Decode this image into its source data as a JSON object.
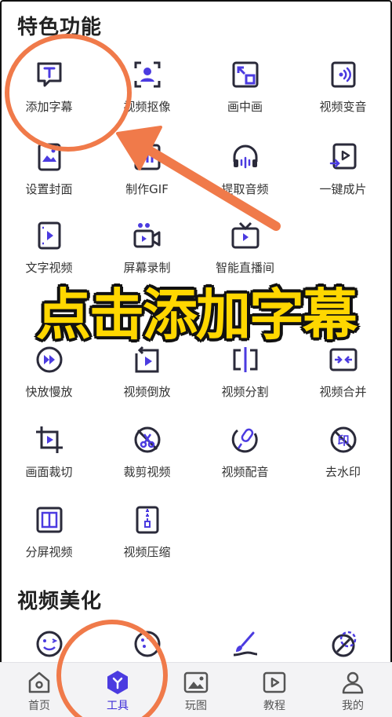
{
  "sections": {
    "features_title": "特色功能",
    "beautify_title": "视频美化"
  },
  "features": [
    {
      "label": "添加字幕",
      "icon": "text-box-icon"
    },
    {
      "label": "视频抠像",
      "icon": "portrait-cutout-icon"
    },
    {
      "label": "画中画",
      "icon": "picture-in-picture-icon"
    },
    {
      "label": "视频变音",
      "icon": "voice-change-icon"
    },
    {
      "label": "设置封面",
      "icon": "cover-image-icon"
    },
    {
      "label": "制作GIF",
      "icon": "gif-icon"
    },
    {
      "label": "提取音频",
      "icon": "headphones-icon"
    },
    {
      "label": "一键成片",
      "icon": "auto-video-icon"
    },
    {
      "label": "文字视频",
      "icon": "text-video-icon"
    },
    {
      "label": "屏幕录制",
      "icon": "screen-record-icon"
    },
    {
      "label": "智能直播间",
      "icon": "live-tv-icon"
    },
    {
      "label": "快放慢放",
      "icon": "speed-icon"
    },
    {
      "label": "视频倒放",
      "icon": "reverse-icon"
    },
    {
      "label": "视频分割",
      "icon": "split-icon"
    },
    {
      "label": "视频合并",
      "icon": "merge-icon"
    },
    {
      "label": "画面裁切",
      "icon": "crop-icon"
    },
    {
      "label": "裁剪视频",
      "icon": "scissors-icon"
    },
    {
      "label": "视频配音",
      "icon": "microphone-icon"
    },
    {
      "label": "去水印",
      "icon": "stamp-icon"
    },
    {
      "label": "分屏视频",
      "icon": "split-screen-icon"
    },
    {
      "label": "视频压缩",
      "icon": "compress-icon"
    }
  ],
  "banner_text": "点击添加字幕",
  "tabbar": [
    {
      "label": "首页",
      "icon": "home-icon",
      "active": false
    },
    {
      "label": "工具",
      "icon": "tools-icon",
      "active": true
    },
    {
      "label": "玩图",
      "icon": "image-icon",
      "active": false
    },
    {
      "label": "教程",
      "icon": "tutorial-icon",
      "active": false
    },
    {
      "label": "我的",
      "icon": "profile-icon",
      "active": false
    }
  ],
  "colors": {
    "icon_dark": "#2a2a3a",
    "icon_accent": "#4b3be0",
    "annotation": "#f07a4a",
    "banner_fill": "#ffd700",
    "tab_active": "#3b2bd8"
  }
}
